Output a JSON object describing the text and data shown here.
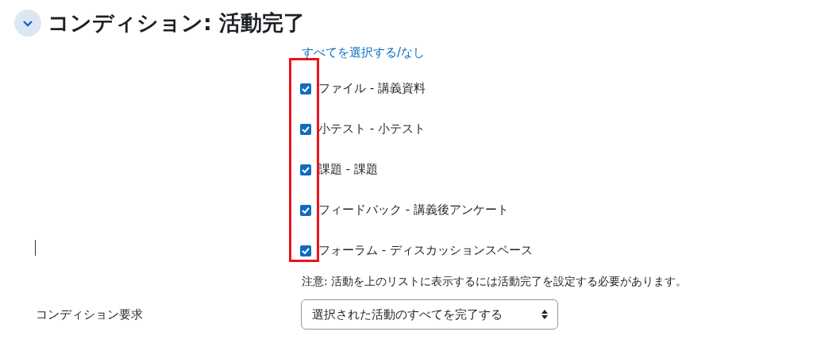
{
  "section": {
    "title": "コンディション: 活動完了",
    "expanded": true
  },
  "select_all_link": "すべてを選択する/なし",
  "activities": [
    {
      "label": "ファイル - 講義資料",
      "checked": true
    },
    {
      "label": "小テスト - 小テスト",
      "checked": true
    },
    {
      "label": "課題 - 課題",
      "checked": true
    },
    {
      "label": "フィードバック - 講義後アンケート",
      "checked": true
    },
    {
      "label": "フォーラム - ディスカッションスペース",
      "checked": true
    }
  ],
  "annotation": {
    "kind": "frame",
    "color": "#e8141c"
  },
  "note": "注意: 活動を上のリストに表示するには活動完了を設定する必要があります。",
  "requirement": {
    "label": "コンディション要求",
    "value": "選択された活動のすべてを完了する"
  }
}
